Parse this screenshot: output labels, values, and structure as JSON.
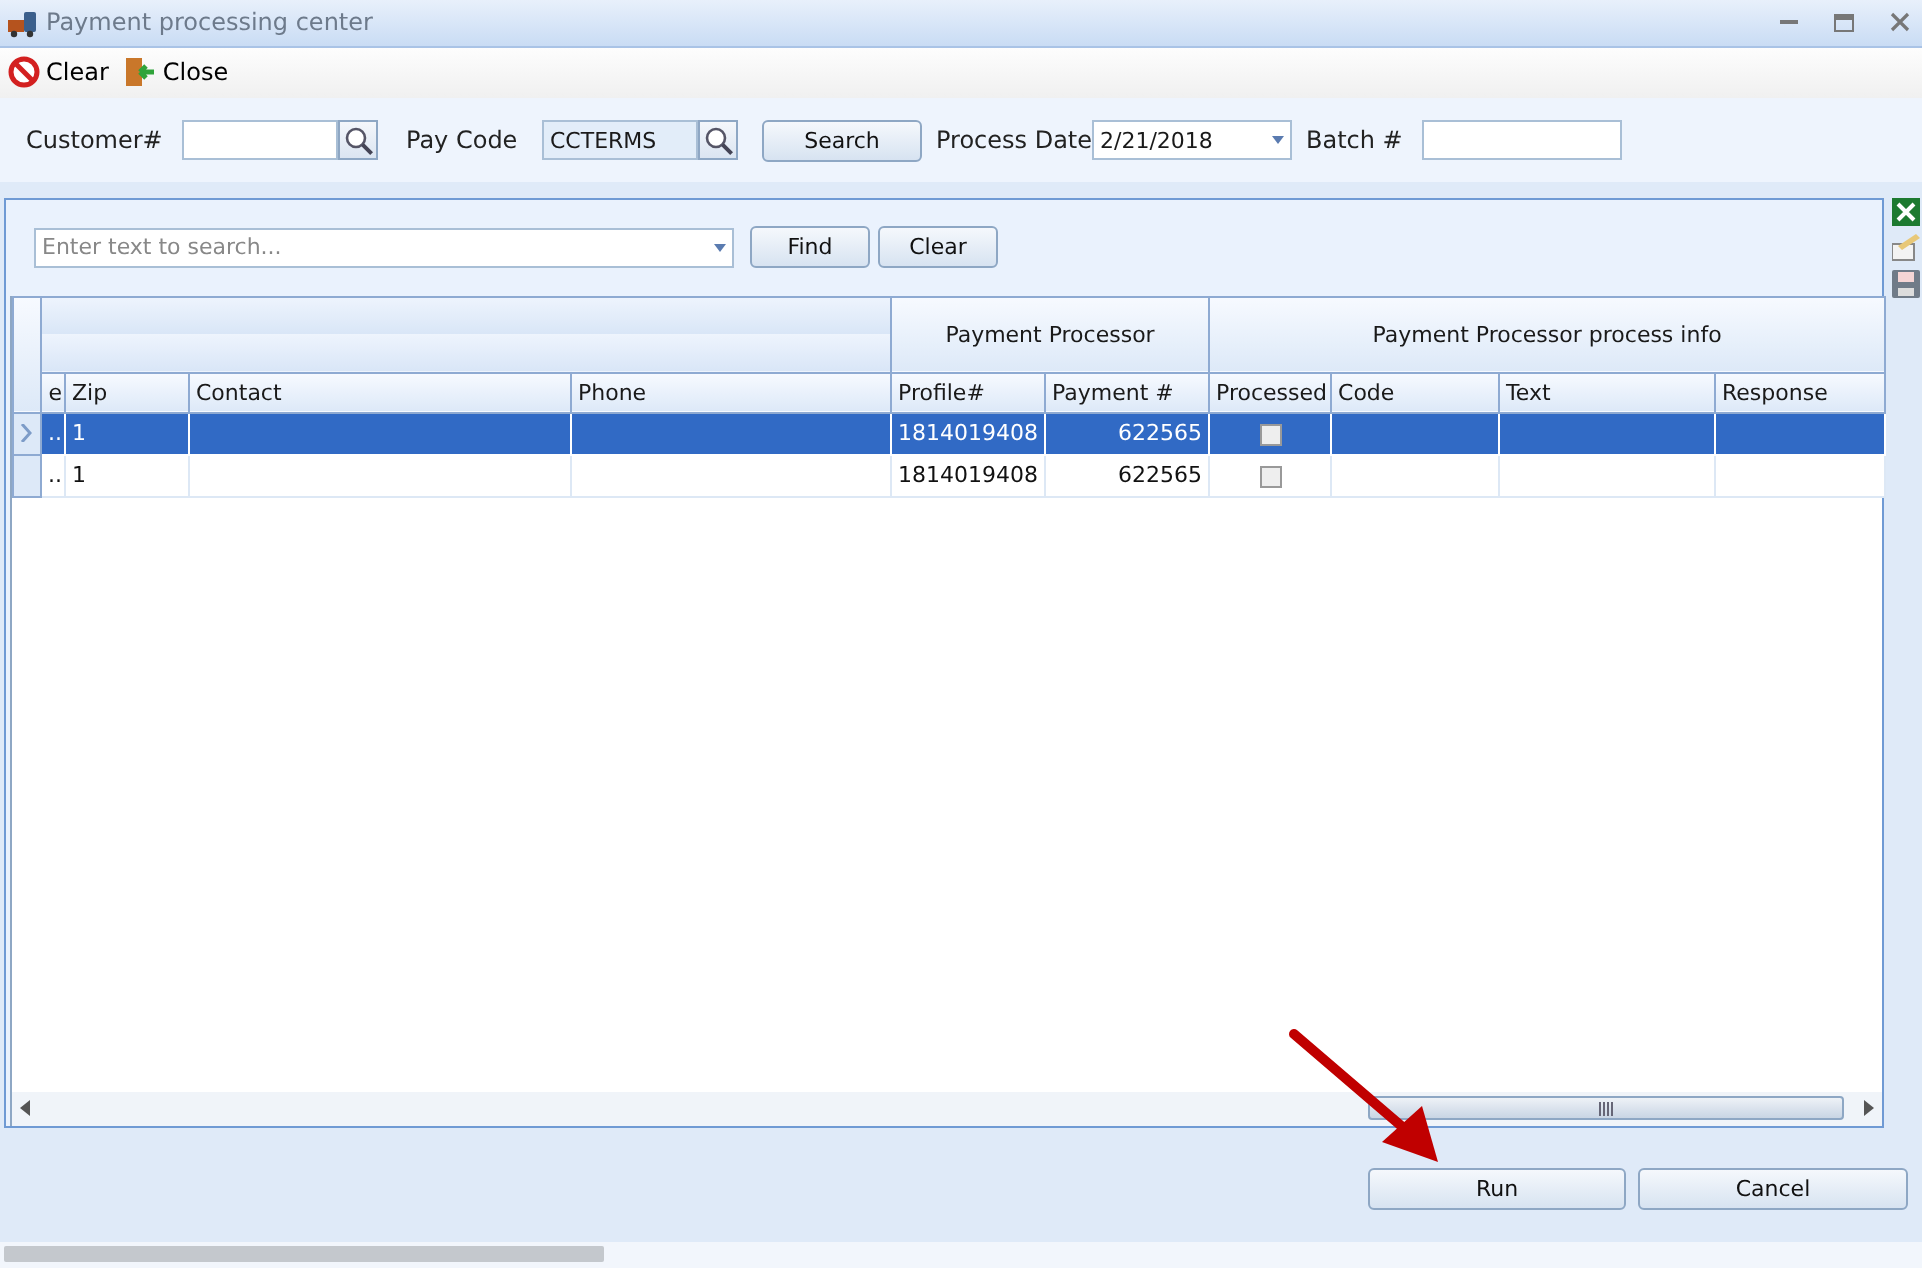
{
  "window": {
    "title": "Payment processing center"
  },
  "toolbar": [
    {
      "kind": "clear",
      "label": "Clear"
    },
    {
      "kind": "close",
      "label": "Close"
    }
  ],
  "filters": {
    "customer_label": "Customer#",
    "pay_code_label": "Pay Code",
    "pay_code_value": "CCTERMS",
    "search_button": "Search",
    "date_label": "Process Date",
    "date_value": "2/21/2018",
    "batch_label": "Batch #"
  },
  "grid_search": {
    "placeholder": "Enter text to search...",
    "find_button": "Find",
    "clear_button": "Clear"
  },
  "bands": [
    {
      "label": "Payment Processor"
    },
    {
      "label": "Payment Processor process info"
    }
  ],
  "columns": [
    "e",
    "Zip",
    "Contact",
    "Phone",
    "Profile#",
    "Payment #",
    "Processed",
    "Code",
    "Text",
    "Response"
  ],
  "rows": [
    {
      "selected": true,
      "cells": [
        "..",
        "1",
        "",
        "",
        "1814019408",
        "622565"
      ],
      "processed": false
    },
    {
      "selected": false,
      "cells": [
        "..",
        "1",
        "",
        "",
        "1814019408",
        "622565"
      ],
      "processed": false
    }
  ],
  "footer": {
    "run_button": "Run",
    "cancel_button": "Cancel"
  }
}
